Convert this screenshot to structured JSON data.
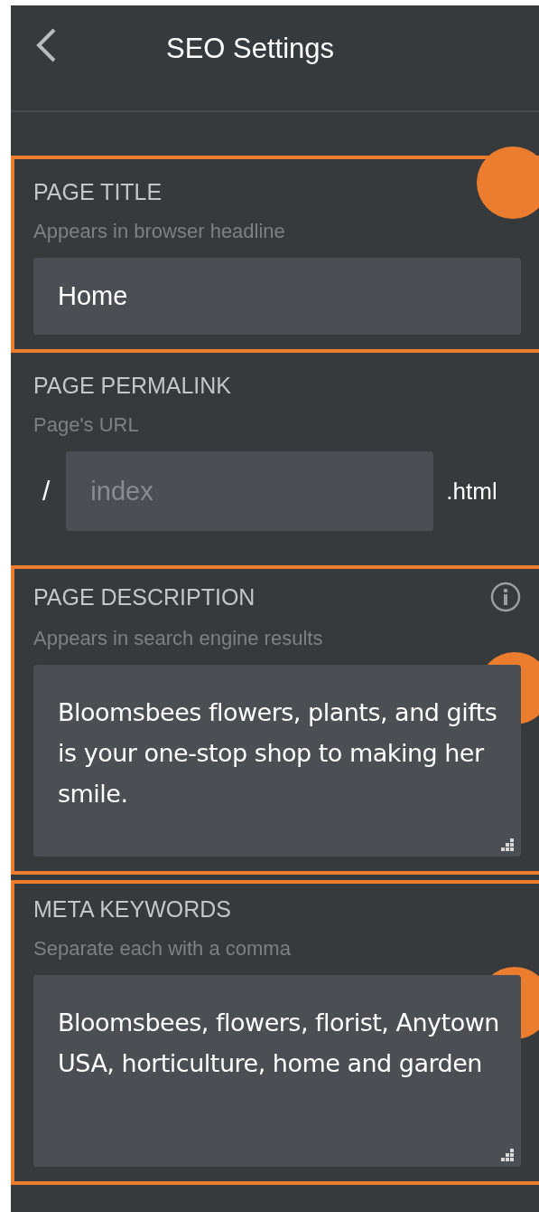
{
  "header": {
    "title": "SEO Settings"
  },
  "sections": [
    {
      "kind": "input",
      "label": "PAGE TITLE",
      "hint": "Appears in browser headline",
      "value": "Home",
      "highlighted": true,
      "info": false
    },
    {
      "kind": "permalink",
      "label": "PAGE PERMALINK",
      "hint": "Page's URL",
      "prefix": "/",
      "placeholder": "index",
      "suffix": ".html",
      "highlighted": false,
      "info": false
    },
    {
      "kind": "textarea",
      "label": "PAGE DESCRIPTION",
      "hint": "Appears in search engine results",
      "value": "Bloomsbees flowers, plants, and gifts is your one-stop shop to making her smile.",
      "highlighted": true,
      "info": true
    },
    {
      "kind": "textarea",
      "label": "META KEYWORDS",
      "hint": "Separate each with a comma",
      "value": "Bloomsbees, flowers, florist, Anytown USA, horticulture, home and garden",
      "highlighted": true,
      "info": false
    }
  ]
}
